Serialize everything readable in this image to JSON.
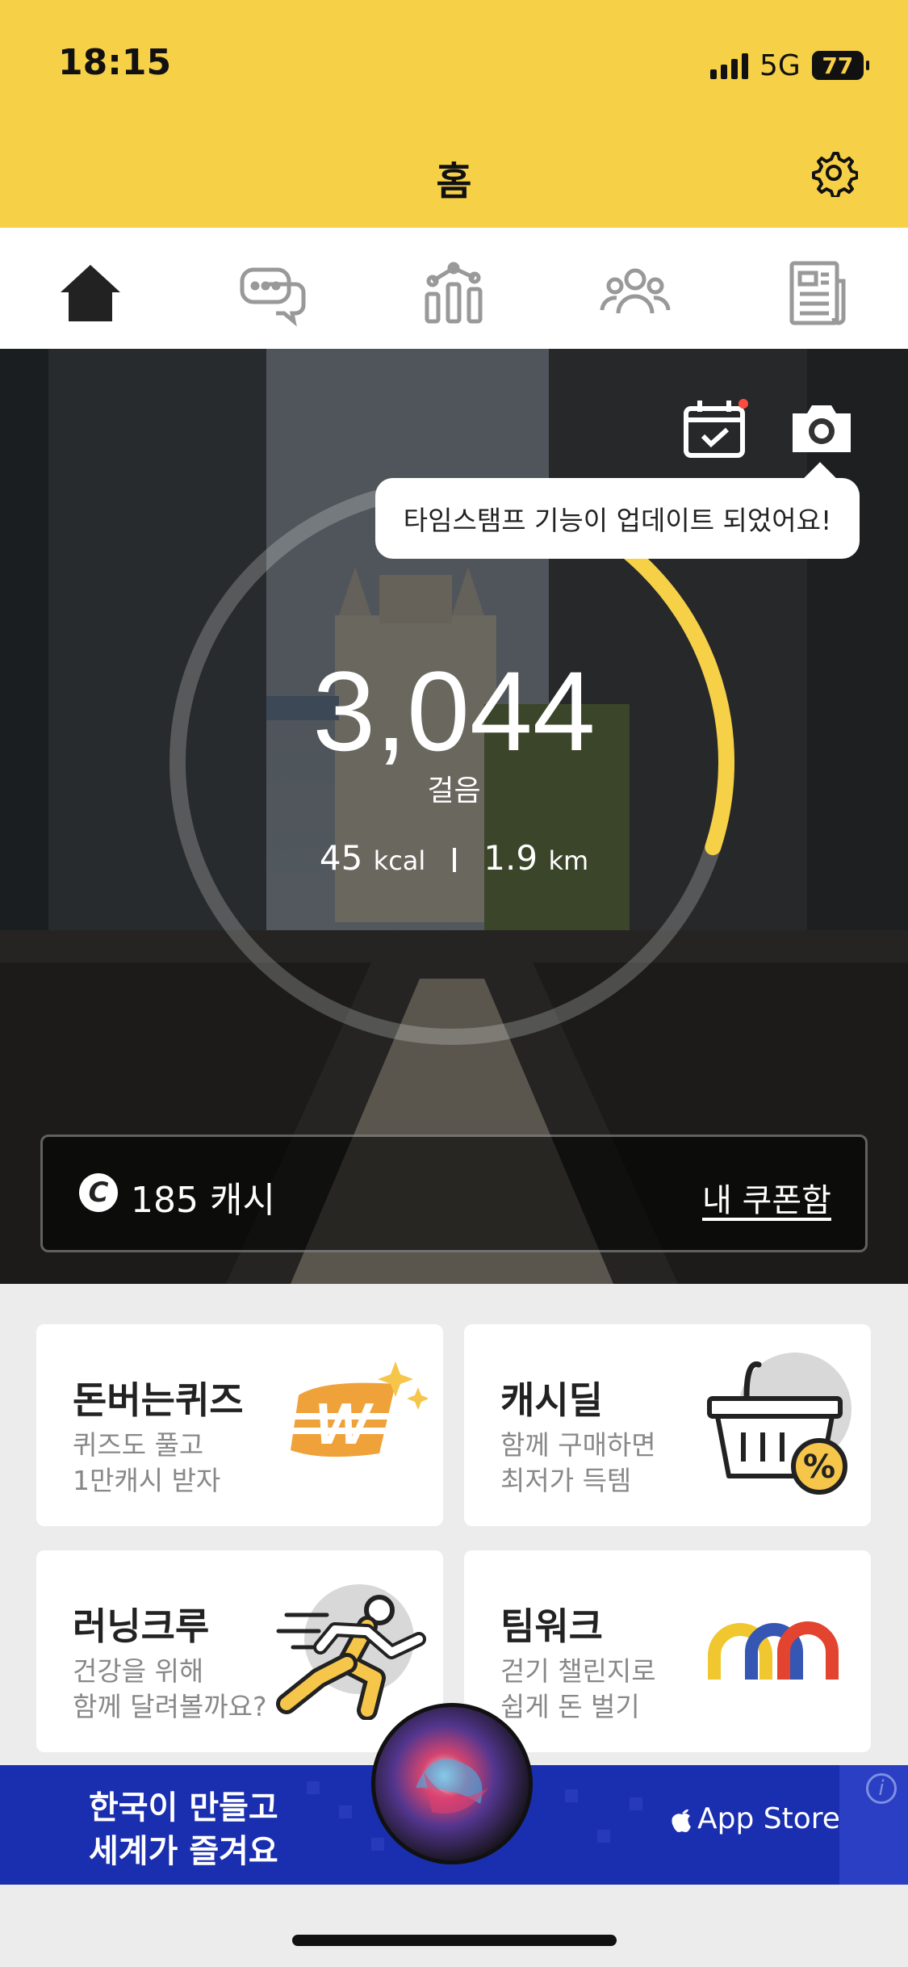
{
  "status": {
    "time": "18:15",
    "network": "5G",
    "battery": "77"
  },
  "header": {
    "title": "홈"
  },
  "tabs": [
    {
      "icon": "home-icon"
    },
    {
      "icon": "chat-icon"
    },
    {
      "icon": "stats-icon"
    },
    {
      "icon": "group-icon"
    },
    {
      "icon": "news-icon"
    }
  ],
  "hero": {
    "tooltip": "타임스탬프 기능이 업데이트 되었어요!",
    "steps": "3,044",
    "steps_label": "걸음",
    "kcal_value": "45",
    "kcal_unit": "kcal",
    "km_value": "1.9",
    "km_unit": "km",
    "ring_progress": 0.3,
    "ring_color": "#f6d047"
  },
  "cash": {
    "amount_text": "185 캐시",
    "icon_letter": "C",
    "coupon_link": "내 쿠폰함"
  },
  "cards": [
    {
      "title": "돈버는퀴즈",
      "sub1": "퀴즈도 풀고",
      "sub2": "1만캐시 받자"
    },
    {
      "title": "캐시딜",
      "sub1": "함께 구매하면",
      "sub2": "최저가 득템"
    },
    {
      "title": "러닝크루",
      "sub1": "건강을 위해",
      "sub2": "함께 달려볼까요?"
    },
    {
      "title": "팀워크",
      "sub1": "걷기 챌린지로",
      "sub2": "쉽게 돈 벌기"
    }
  ],
  "ad": {
    "line1": "한국이 만들고",
    "line2": "세계가 즐겨요",
    "store": "App Store",
    "info": "i"
  },
  "colors": {
    "brand_yellow": "#f6d047",
    "ad_blue": "#1a2eb0"
  }
}
